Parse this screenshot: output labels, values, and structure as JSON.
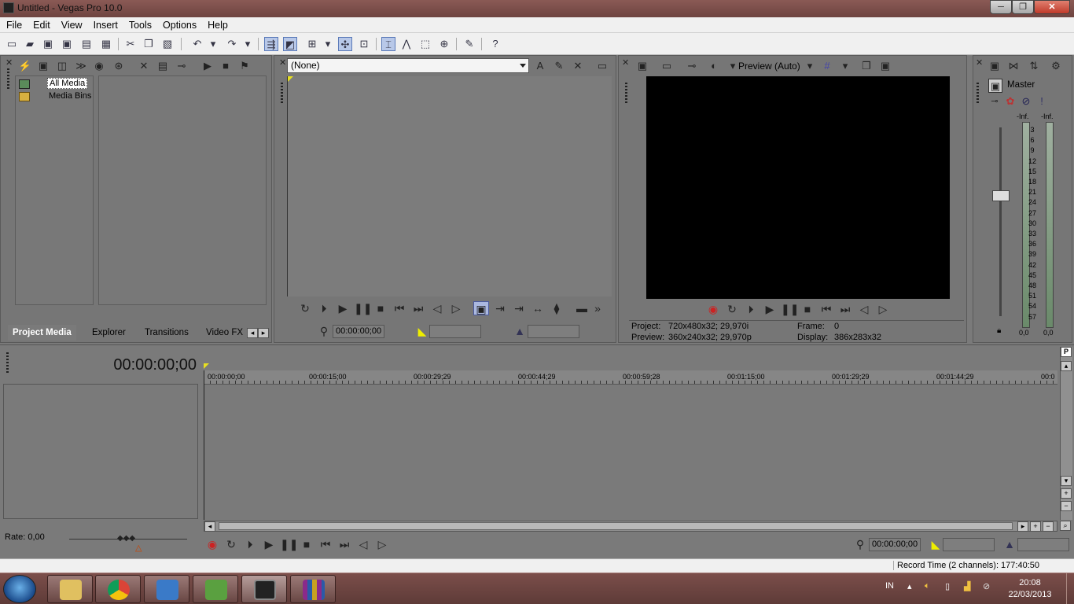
{
  "window": {
    "title": "Untitled - Vegas Pro 10.0",
    "min_label": "─",
    "max_label": "❐",
    "close_label": "✕"
  },
  "menu": [
    "File",
    "Edit",
    "View",
    "Insert",
    "Tools",
    "Options",
    "Help"
  ],
  "project_media": {
    "tree": [
      "All Media",
      "Media Bins"
    ],
    "tabs": [
      "Project Media",
      "Explorer",
      "Transitions",
      "Video FX"
    ]
  },
  "trimmer": {
    "dropdown_value": "(None)",
    "timecode": "00:00:00;00"
  },
  "preview": {
    "mode_label": "Preview (Auto)",
    "project_label": "Project:",
    "project_value": "720x480x32; 29,970i",
    "preview_label": "Preview:",
    "preview_value": "360x240x32; 29,970p",
    "frame_label": "Frame:",
    "frame_value": "0",
    "display_label": "Display:",
    "display_value": "386x283x32"
  },
  "mixer": {
    "master_label": "Master",
    "peak_left": "-Inf.",
    "peak_right": "-Inf.",
    "scale": [
      "3",
      "6",
      "9",
      "12",
      "15",
      "18",
      "21",
      "24",
      "27",
      "30",
      "33",
      "36",
      "39",
      "42",
      "45",
      "48",
      "51",
      "54",
      "57"
    ],
    "level_left": "0,0",
    "level_right": "0,0"
  },
  "timeline": {
    "cursor_time": "00:00:00;00",
    "ruler": [
      "00:00:00;00",
      "00:00:15;00",
      "00:00:29;29",
      "00:00:44;29",
      "00:00:59;28",
      "00:01:15;00",
      "00:01:29;29",
      "00:01:44;29",
      "00:0"
    ],
    "rate": "Rate: 0,00",
    "transport_timecode": "00:00:00;00"
  },
  "status": {
    "record_time": "Record Time (2 channels): 177:40:50"
  },
  "taskbar": {
    "language": "IN",
    "time": "20:08",
    "date": "22/03/2013"
  }
}
